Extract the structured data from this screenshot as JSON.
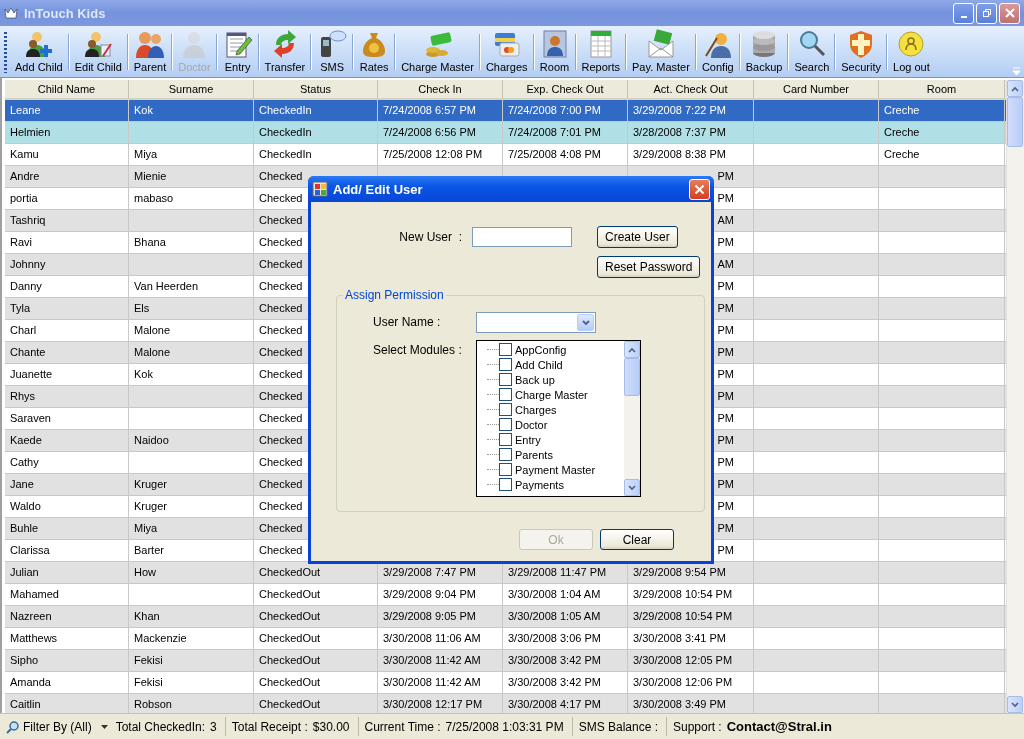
{
  "window": {
    "title": "InTouch Kids"
  },
  "toolbar": [
    {
      "label": "Add Child",
      "disabled": false
    },
    {
      "label": "Edit Child",
      "disabled": false
    },
    {
      "label": "Parent",
      "disabled": false
    },
    {
      "label": "Doctor",
      "disabled": true
    },
    {
      "label": "Entry",
      "disabled": false
    },
    {
      "label": "Transfer",
      "disabled": false
    },
    {
      "label": "SMS",
      "disabled": false
    },
    {
      "label": "Rates",
      "disabled": false
    },
    {
      "label": "Charge Master",
      "disabled": false
    },
    {
      "label": "Charges",
      "disabled": false
    },
    {
      "label": "Room",
      "disabled": false
    },
    {
      "label": "Reports",
      "disabled": false
    },
    {
      "label": "Pay. Master",
      "disabled": false
    },
    {
      "label": "Config",
      "disabled": false
    },
    {
      "label": "Backup",
      "disabled": false
    },
    {
      "label": "Search",
      "disabled": false
    },
    {
      "label": "Security",
      "disabled": false
    },
    {
      "label": "Log out",
      "disabled": false
    }
  ],
  "table": {
    "columns": [
      "Child Name",
      "Surname",
      "Status",
      "Check In",
      "Exp. Check Out",
      "Act. Check Out",
      "Card Number",
      "Room"
    ],
    "rows": [
      {
        "child_name": "Leane",
        "surname": "Kok",
        "status": "CheckedIn",
        "check_in": "7/24/2008 6:57 PM",
        "exp_check_out": "7/24/2008 7:00 PM",
        "act_check_out": "3/29/2008 7:22 PM",
        "room": "Creche",
        "selected": true,
        "highlighted": false
      },
      {
        "child_name": "Helmien",
        "status": "CheckedIn",
        "check_in": "7/24/2008 6:56 PM",
        "exp_check_out": "7/24/2008 7:01 PM",
        "act_check_out": "3/28/2008 7:37 PM",
        "room": "Creche",
        "selected": false,
        "highlighted": true
      },
      {
        "child_name": "Kamu",
        "surname": "Miya",
        "status": "CheckedIn",
        "check_in": "7/25/2008 12:08 PM",
        "exp_check_out": "7/25/2008 4:08 PM",
        "act_check_out": "3/29/2008 8:38 PM",
        "room": "Creche",
        "selected": false,
        "highlighted": false
      },
      {
        "child_name": "Andre",
        "surname": "Mienie",
        "status": "Checked",
        "act_check_out": "PM",
        "selected": false,
        "highlighted": false
      },
      {
        "child_name": "portia",
        "surname": "mabaso",
        "status": "Checked",
        "act_check_out": "PM",
        "selected": false,
        "highlighted": false
      },
      {
        "child_name": "Tashriq",
        "status": "Checked",
        "act_check_out": "AM",
        "selected": false,
        "highlighted": false
      },
      {
        "child_name": "Ravi",
        "surname": "Bhana",
        "status": "Checked",
        "act_check_out": "PM",
        "selected": false,
        "highlighted": false
      },
      {
        "child_name": "Johnny",
        "status": "Checked",
        "act_check_out": "AM",
        "selected": false,
        "highlighted": false
      },
      {
        "child_name": "Danny",
        "surname": "Van Heerden",
        "status": "Checked",
        "act_check_out": "PM",
        "selected": false,
        "highlighted": false
      },
      {
        "child_name": "Tyla",
        "surname": "Els",
        "status": "Checked",
        "act_check_out": "PM",
        "selected": false,
        "highlighted": false
      },
      {
        "child_name": "Charl",
        "surname": "Malone",
        "status": "Checked",
        "act_check_out": "PM",
        "selected": false,
        "highlighted": false
      },
      {
        "child_name": "Chante",
        "surname": "Malone",
        "status": "Checked",
        "act_check_out": "PM",
        "selected": false,
        "highlighted": false
      },
      {
        "child_name": "Juanette",
        "surname": "Kok",
        "status": "Checked",
        "act_check_out": "PM",
        "selected": false,
        "highlighted": false
      },
      {
        "child_name": "Rhys",
        "status": "Checked",
        "act_check_out": "PM",
        "selected": false,
        "highlighted": false
      },
      {
        "child_name": "Saraven",
        "status": "Checked",
        "act_check_out": "PM",
        "selected": false,
        "highlighted": false
      },
      {
        "child_name": "Kaede",
        "surname": "Naidoo",
        "status": "Checked",
        "act_check_out": "PM",
        "selected": false,
        "highlighted": false
      },
      {
        "child_name": "Cathy",
        "status": "Checked",
        "act_check_out": "PM",
        "selected": false,
        "highlighted": false
      },
      {
        "child_name": "Jane",
        "surname": "Kruger",
        "status": "Checked",
        "act_check_out": "PM",
        "selected": false,
        "highlighted": false
      },
      {
        "child_name": "Waldo",
        "surname": "Kruger",
        "status": "Checked",
        "act_check_out": "PM",
        "selected": false,
        "highlighted": false
      },
      {
        "child_name": "Buhle",
        "surname": "Miya",
        "status": "Checked",
        "act_check_out": "PM",
        "selected": false,
        "highlighted": false
      },
      {
        "child_name": "Clarissa",
        "surname": "Barter",
        "status": "Checked",
        "act_check_out": "PM",
        "selected": false,
        "highlighted": false
      },
      {
        "child_name": "Julian",
        "surname": "How",
        "status": "CheckedOut",
        "check_in": "3/29/2008 7:47 PM",
        "exp_check_out": "3/29/2008 11:47 PM",
        "act_check_out": "3/29/2008 9:54 PM",
        "selected": false,
        "highlighted": false
      },
      {
        "child_name": "Mahamed",
        "status": "CheckedOut",
        "check_in": "3/29/2008 9:04 PM",
        "exp_check_out": "3/30/2008 1:04 AM",
        "act_check_out": "3/29/2008 10:54 PM",
        "selected": false,
        "highlighted": false
      },
      {
        "child_name": "Nazreen",
        "surname": "Khan",
        "status": "CheckedOut",
        "check_in": "3/29/2008 9:05 PM",
        "exp_check_out": "3/30/2008 1:05 AM",
        "act_check_out": "3/29/2008 10:54 PM",
        "selected": false,
        "highlighted": false
      },
      {
        "child_name": "Matthews",
        "surname": "Mackenzie",
        "status": "CheckedOut",
        "check_in": "3/30/2008 11:06 AM",
        "exp_check_out": "3/30/2008 3:06 PM",
        "act_check_out": "3/30/2008 3:41 PM",
        "selected": false,
        "highlighted": false
      },
      {
        "child_name": "Sipho",
        "surname": "Fekisi",
        "status": "CheckedOut",
        "check_in": "3/30/2008 11:42 AM",
        "exp_check_out": "3/30/2008 3:42 PM",
        "act_check_out": "3/30/2008 12:05 PM",
        "selected": false,
        "highlighted": false
      },
      {
        "child_name": "Amanda",
        "surname": "Fekisi",
        "status": "CheckedOut",
        "check_in": "3/30/2008 11:42 AM",
        "exp_check_out": "3/30/2008 3:42 PM",
        "act_check_out": "3/30/2008 12:06 PM",
        "selected": false,
        "highlighted": false
      },
      {
        "child_name": "Caitlin",
        "surname": "Robson",
        "status": "CheckedOut",
        "check_in": "3/30/2008 12:17 PM",
        "exp_check_out": "3/30/2008 4:17 PM",
        "act_check_out": "3/30/2008 3:49 PM",
        "selected": false,
        "highlighted": false
      }
    ]
  },
  "dialog": {
    "title": "Add/ Edit User",
    "new_user_label": "New User  :",
    "create_button": "Create User",
    "reset_button": "Reset Password",
    "group_title": "Assign Permission",
    "user_name_label": "User Name :",
    "modules_label": "Select Modules :",
    "modules": [
      {
        "label": "AppConfig",
        "checked": false
      },
      {
        "label": "Add Child",
        "checked": false
      },
      {
        "label": "Back up",
        "checked": false
      },
      {
        "label": "Charge Master",
        "checked": false
      },
      {
        "label": "Charges",
        "checked": false
      },
      {
        "label": "Doctor",
        "checked": false
      },
      {
        "label": "Entry",
        "checked": false
      },
      {
        "label": "Parents",
        "checked": false
      },
      {
        "label": "Payment Master",
        "checked": false
      },
      {
        "label": "Payments",
        "checked": false
      }
    ],
    "ok_button": {
      "label": "Ok",
      "disabled": true
    },
    "clear_button": {
      "label": "Clear",
      "disabled": false
    }
  },
  "status_bar": {
    "filter": "Filter By (All)",
    "items": [
      {
        "label": "Total CheckedIn:",
        "value": "3",
        "kind": "plain"
      },
      {
        "label": "Total Receipt :",
        "value": "$30.00",
        "kind": "plain"
      },
      {
        "label": "Current Time :",
        "value": "7/25/2008 1:03:31 PM",
        "kind": "plain"
      },
      {
        "label": "SMS Balance :",
        "kind": "plain"
      },
      {
        "label": "Support :",
        "value": "Contact@Stral.in",
        "kind": "strong"
      }
    ]
  }
}
